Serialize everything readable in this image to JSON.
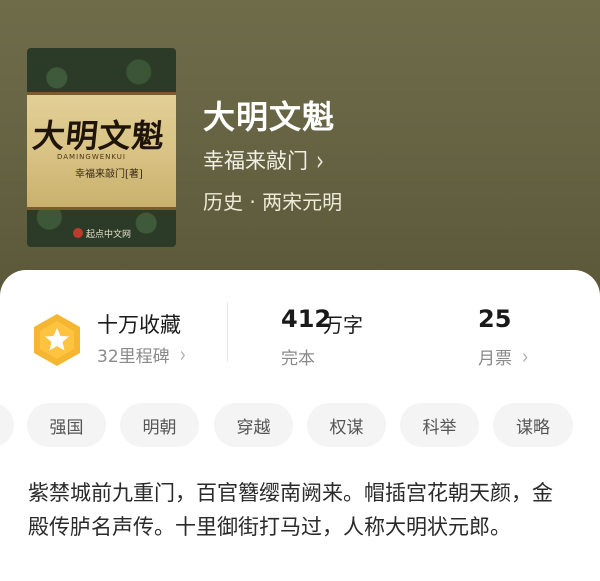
{
  "book": {
    "cover": {
      "title": "大明文魁",
      "pinyin": "DAMINGWENKUI",
      "author": "幸福来敲门[著]",
      "logo": "起点中文网"
    },
    "title": "大明文魁",
    "author": "幸福来敲门",
    "genre": "历史 · 两宋元明"
  },
  "stats": {
    "collection": {
      "title": "十万收藏",
      "sub": "32里程碑"
    },
    "words": {
      "number": "412",
      "unit": "万字",
      "sub": "完本"
    },
    "tickets": {
      "number": "25",
      "sub": "月票"
    }
  },
  "tags": [
    "强国",
    "明朝",
    "穿越",
    "权谋",
    "科举",
    "谋略"
  ],
  "description": "紫禁城前九重门，百官簪缨南阙来。帽插宫花朝天颜，金殿传胪名声传。十里御街打马过，人称大明状元郎。",
  "icons": {
    "author_chevron": "chevron-right-icon",
    "badge": "star-badge-icon"
  },
  "colors": {
    "badge_gold": "#f5b632",
    "badge_light": "#ffd261"
  }
}
